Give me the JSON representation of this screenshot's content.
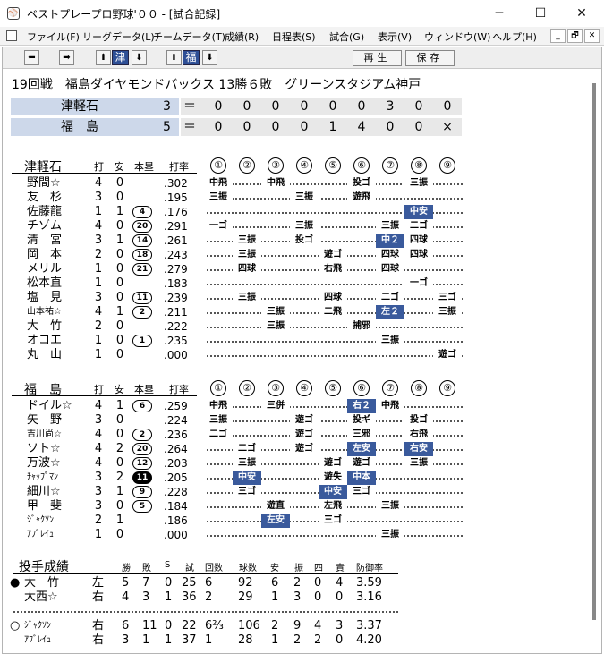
{
  "window": {
    "title": "ベストプレープロ野球'００ - [試合記録]",
    "app_icon": "baseball-app-icon",
    "minimize": "─",
    "maximize": "☐",
    "close": "✕"
  },
  "menu": [
    "ファイル(F)",
    "リーグデータ(L)",
    "チームデータ(T)",
    "成績(R)",
    "日程表(S)",
    "試合(G)",
    "表示(V)",
    "ウィンドウ(W)",
    "ヘルプ(H)"
  ],
  "mdi_buttons": [
    "_",
    "🗗",
    "✕"
  ],
  "toolbar": {
    "team1": "津",
    "team2": "福",
    "replay": "再生",
    "save": "保存",
    "left_arrow": "⬅",
    "right_arrow": "➡",
    "up_arrow": "⬆",
    "down_arrow": "⬇"
  },
  "game": {
    "header": "19回戦　福島ダイヤモンドバックス 13勝６敗　グリーンスタジアム神戸"
  },
  "scoreboard": [
    {
      "team": "津軽石",
      "runs": "3",
      "eq": "＝",
      "innings": [
        "0",
        "0",
        "0",
        "0",
        "0",
        "0",
        "3",
        "0",
        "0"
      ]
    },
    {
      "team": "福　島",
      "runs": "5",
      "eq": "＝",
      "innings": [
        "0",
        "0",
        "0",
        "0",
        "1",
        "4",
        "0",
        "0",
        "×"
      ]
    }
  ],
  "batting_headers": {
    "ab": "打",
    "h": "安",
    "hr": "本塁",
    "avg": "打率",
    "innings": [
      "①",
      "②",
      "③",
      "④",
      "⑤",
      "⑥",
      "⑦",
      "⑧",
      "⑨"
    ]
  },
  "away": {
    "team": "津軽石",
    "batters": [
      {
        "name": "野間☆",
        "ab": "4",
        "h": "0",
        "hr": "",
        "avg": ".302",
        "pa": [
          {
            "inn": 1,
            "r": "中飛"
          },
          {
            "inn": 3,
            "r": "中飛"
          },
          {
            "inn": 6,
            "r": "投ゴ"
          },
          {
            "inn": 8,
            "r": "三振"
          }
        ]
      },
      {
        "name": "友　杉",
        "ab": "3",
        "h": "0",
        "hr": "",
        "avg": ".195",
        "pa": [
          {
            "inn": 1,
            "r": "三振"
          },
          {
            "inn": 4,
            "r": "三振"
          },
          {
            "inn": 6,
            "r": "遊飛"
          }
        ]
      },
      {
        "name": "佐藤龍",
        "ab": "1",
        "h": "1",
        "hr": "4",
        "avg": ".176",
        "pa": [
          {
            "inn": 8,
            "r": "中安",
            "hl": true
          }
        ]
      },
      {
        "name": "チゾム",
        "ab": "4",
        "h": "0",
        "hr": "20",
        "avg": ".291",
        "pa": [
          {
            "inn": 1,
            "r": "一ゴ"
          },
          {
            "inn": 4,
            "r": "三振"
          },
          {
            "inn": 7,
            "r": "三振"
          },
          {
            "inn": 8,
            "r": "二ゴ"
          }
        ]
      },
      {
        "name": "清　宮",
        "ab": "3",
        "h": "1",
        "hr": "14",
        "avg": ".261",
        "pa": [
          {
            "inn": 2,
            "r": "三振"
          },
          {
            "inn": 4,
            "r": "投ゴ"
          },
          {
            "inn": 7,
            "r": "中２",
            "hl": true
          },
          {
            "inn": 8,
            "r": "四球"
          }
        ]
      },
      {
        "name": "岡　本",
        "ab": "2",
        "h": "0",
        "hr": "18",
        "avg": ".243",
        "pa": [
          {
            "inn": 2,
            "r": "三振"
          },
          {
            "inn": 5,
            "r": "遊ゴ"
          },
          {
            "inn": 7,
            "r": "四球"
          },
          {
            "inn": 8,
            "r": "四球"
          }
        ]
      },
      {
        "name": "メリル",
        "ab": "1",
        "h": "0",
        "hr": "21",
        "avg": ".279",
        "pa": [
          {
            "inn": 2,
            "r": "四球"
          },
          {
            "inn": 5,
            "r": "右飛"
          },
          {
            "inn": 7,
            "r": "四球"
          }
        ]
      },
      {
        "name": "松本直",
        "ab": "1",
        "h": "0",
        "hr": "",
        "avg": ".183",
        "pa": [
          {
            "inn": 8,
            "r": "一ゴ"
          }
        ]
      },
      {
        "name": "塩　見",
        "ab": "3",
        "h": "0",
        "hr": "11",
        "avg": ".239",
        "pa": [
          {
            "inn": 2,
            "r": "三振"
          },
          {
            "inn": 5,
            "r": "四球"
          },
          {
            "inn": 7,
            "r": "二ゴ"
          },
          {
            "inn": 9,
            "r": "三ゴ"
          }
        ]
      },
      {
        "name": "山本祐☆",
        "ab": "4",
        "h": "1",
        "hr": "2",
        "avg": ".211",
        "small": true,
        "pa": [
          {
            "inn": 3,
            "r": "三振"
          },
          {
            "inn": 5,
            "r": "二飛"
          },
          {
            "inn": 7,
            "r": "左２",
            "hl": true
          },
          {
            "inn": 9,
            "r": "三振"
          }
        ]
      },
      {
        "name": "大　竹",
        "ab": "2",
        "h": "0",
        "hr": "",
        "avg": ".222",
        "pa": [
          {
            "inn": 3,
            "r": "三振"
          },
          {
            "inn": 6,
            "r": "捕邪"
          }
        ]
      },
      {
        "name": "オコエ",
        "ab": "1",
        "h": "0",
        "hr": "1",
        "avg": ".235",
        "pa": [
          {
            "inn": 7,
            "r": "三振"
          }
        ]
      },
      {
        "name": "丸　山",
        "ab": "1",
        "h": "0",
        "hr": "",
        "avg": ".000",
        "pa": [
          {
            "inn": 9,
            "r": "遊ゴ"
          }
        ]
      }
    ]
  },
  "home": {
    "team": "福　島",
    "batters": [
      {
        "name": "ドイル☆",
        "ab": "4",
        "h": "1",
        "hr": "6",
        "avg": ".259",
        "pa": [
          {
            "inn": 1,
            "r": "中飛"
          },
          {
            "inn": 3,
            "r": "三併"
          },
          {
            "inn": 6,
            "r": "右２",
            "hl": true
          },
          {
            "inn": 7,
            "r": "中飛"
          }
        ]
      },
      {
        "name": "矢　野",
        "ab": "3",
        "h": "0",
        "hr": "",
        "avg": ".224",
        "pa": [
          {
            "inn": 1,
            "r": "三振"
          },
          {
            "inn": 4,
            "r": "遊ゴ"
          },
          {
            "inn": 6,
            "r": "投ギ"
          },
          {
            "inn": 8,
            "r": "投ゴ"
          }
        ]
      },
      {
        "name": "吉川尚☆",
        "ab": "4",
        "h": "0",
        "hr": "2",
        "avg": ".236",
        "small": true,
        "pa": [
          {
            "inn": 1,
            "r": "二ゴ"
          },
          {
            "inn": 4,
            "r": "遊ゴ"
          },
          {
            "inn": 6,
            "r": "三邪"
          },
          {
            "inn": 8,
            "r": "右飛"
          }
        ]
      },
      {
        "name": "ソト☆",
        "ab": "4",
        "h": "2",
        "hr": "20",
        "avg": ".264",
        "pa": [
          {
            "inn": 2,
            "r": "二ゴ"
          },
          {
            "inn": 4,
            "r": "遊ゴ"
          },
          {
            "inn": 6,
            "r": "左安",
            "hl": true
          },
          {
            "inn": 8,
            "r": "右安",
            "hl": true
          }
        ]
      },
      {
        "name": "万波☆",
        "ab": "4",
        "h": "0",
        "hr": "12",
        "avg": ".203",
        "pa": [
          {
            "inn": 2,
            "r": "三振"
          },
          {
            "inn": 5,
            "r": "遊ゴ"
          },
          {
            "inn": 6,
            "r": "遊ゴ"
          },
          {
            "inn": 8,
            "r": "三振"
          }
        ]
      },
      {
        "name": "ﾁｬｯﾌﾟﾏﾝ",
        "ab": "3",
        "h": "2",
        "hr": "11",
        "avg": ".205",
        "small": true,
        "inv": true,
        "pa": [
          {
            "inn": 2,
            "r": "中安",
            "hl": true
          },
          {
            "inn": 5,
            "r": "遊失"
          },
          {
            "inn": 6,
            "r": "中本",
            "hl": true
          }
        ]
      },
      {
        "name": "細川☆",
        "ab": "3",
        "h": "1",
        "hr": "9",
        "avg": ".228",
        "pa": [
          {
            "inn": 2,
            "r": "三ゴ"
          },
          {
            "inn": 5,
            "r": "中安",
            "hl": true
          },
          {
            "inn": 6,
            "r": "三ゴ"
          }
        ]
      },
      {
        "name": "甲　斐",
        "ab": "3",
        "h": "0",
        "hr": "5",
        "avg": ".184",
        "pa": [
          {
            "inn": 3,
            "r": "遊直"
          },
          {
            "inn": 5,
            "r": "左飛"
          },
          {
            "inn": 7,
            "r": "三振"
          }
        ]
      },
      {
        "name": "ｼﾞｬｸｿﾝ",
        "ab": "2",
        "h": "1",
        "hr": "",
        "avg": ".186",
        "small": true,
        "pa": [
          {
            "inn": 3,
            "r": "左安",
            "hl": true
          },
          {
            "inn": 5,
            "r": "三ゴ"
          }
        ]
      },
      {
        "name": "ｱﾌﾞﾚｲｭ",
        "ab": "1",
        "h": "0",
        "hr": "",
        "avg": ".000",
        "small": true,
        "pa": [
          {
            "inn": 7,
            "r": "三振"
          }
        ]
      }
    ]
  },
  "pitching": {
    "title": "投手成績",
    "headers": [
      "勝",
      "敗",
      "S",
      "試",
      "回数",
      "球数",
      "安",
      "振",
      "四",
      "責",
      "防御率"
    ],
    "away": [
      {
        "mark": "●",
        "name": "大　竹",
        "hand": "左",
        "w": "5",
        "l": "7",
        "s": "0",
        "g": "25",
        "ip": "6",
        "np": "92",
        "h": "6",
        "so": "2",
        "bb": "0",
        "er": "4",
        "era": "3.59"
      },
      {
        "mark": "",
        "name": "大西☆",
        "hand": "右",
        "w": "4",
        "l": "3",
        "s": "1",
        "g": "36",
        "ip": "2",
        "np": "29",
        "h": "1",
        "so": "3",
        "bb": "0",
        "er": "0",
        "era": "3.16"
      }
    ],
    "home": [
      {
        "mark": "○",
        "name": "ｼﾞｬｸｿﾝ",
        "hand": "右",
        "w": "6",
        "l": "11",
        "s": "0",
        "g": "22",
        "ip": "6⅔",
        "np": "106",
        "h": "2",
        "so": "9",
        "bb": "4",
        "er": "3",
        "era": "3.37"
      },
      {
        "mark": "",
        "name": "ｱﾌﾞﾚｲｭ",
        "hand": "右",
        "w": "3",
        "l": "1",
        "s": "1",
        "g": "37",
        "ip": "1",
        "np": "28",
        "h": "1",
        "so": "2",
        "bb": "2",
        "er": "0",
        "era": "4.20"
      }
    ]
  }
}
